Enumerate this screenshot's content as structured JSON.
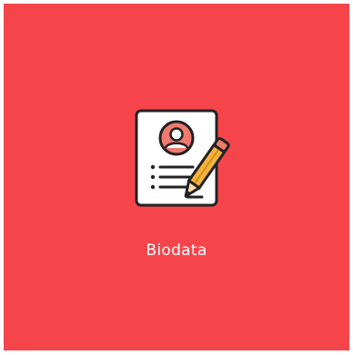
{
  "tile": {
    "label": "Biodata",
    "icon": "biodata-document-pencil-icon",
    "background_color": "#f5454b",
    "label_color": "#ffffff"
  }
}
